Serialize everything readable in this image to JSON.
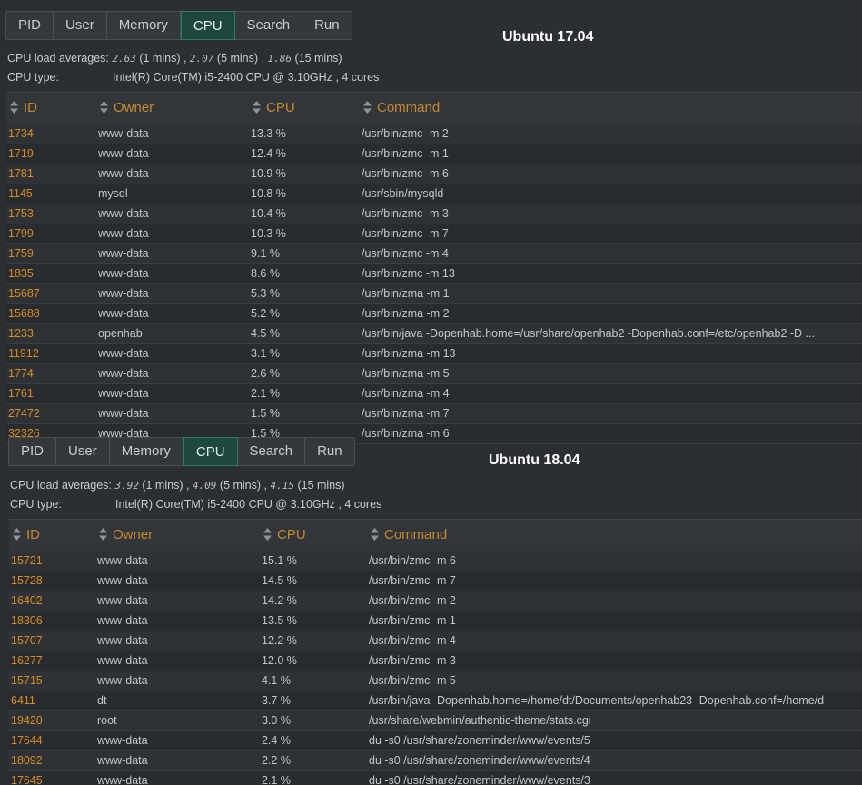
{
  "panels": [
    {
      "os_title": "Ubuntu 17.04",
      "tabs": [
        "PID",
        "User",
        "Memory",
        "CPU",
        "Search",
        "Run"
      ],
      "active_tab": 3,
      "load_label": "CPU load averages:",
      "load": {
        "one": "2.63",
        "one_unit": "(1 mins) ,",
        "five": "2.07",
        "five_unit": "(5 mins) ,",
        "fifteen": "1.86",
        "fifteen_unit": "(15 mins)"
      },
      "type_label": "CPU type:",
      "cpu_type": "Intel(R) Core(TM) i5-2400 CPU @ 3.10GHz , 4 cores",
      "columns": [
        "ID",
        "Owner",
        "CPU",
        "Command"
      ],
      "rows": [
        {
          "id": "1734",
          "owner": "www-data",
          "cpu": "13.3 %",
          "cmd": "/usr/bin/zmc -m 2"
        },
        {
          "id": "1719",
          "owner": "www-data",
          "cpu": "12.4 %",
          "cmd": "/usr/bin/zmc -m 1"
        },
        {
          "id": "1781",
          "owner": "www-data",
          "cpu": "10.9 %",
          "cmd": "/usr/bin/zmc -m 6"
        },
        {
          "id": "1145",
          "owner": "mysql",
          "cpu": "10.8 %",
          "cmd": "/usr/sbin/mysqld"
        },
        {
          "id": "1753",
          "owner": "www-data",
          "cpu": "10.4 %",
          "cmd": "/usr/bin/zmc -m 3"
        },
        {
          "id": "1799",
          "owner": "www-data",
          "cpu": "10.3 %",
          "cmd": "/usr/bin/zmc -m 7"
        },
        {
          "id": "1759",
          "owner": "www-data",
          "cpu": "9.1 %",
          "cmd": "/usr/bin/zmc -m 4"
        },
        {
          "id": "1835",
          "owner": "www-data",
          "cpu": "8.6 %",
          "cmd": "/usr/bin/zmc -m 13"
        },
        {
          "id": "15687",
          "owner": "www-data",
          "cpu": "5.3 %",
          "cmd": "/usr/bin/zma -m 1"
        },
        {
          "id": "15688",
          "owner": "www-data",
          "cpu": "5.2 %",
          "cmd": "/usr/bin/zma -m 2"
        },
        {
          "id": "1233",
          "owner": "openhab",
          "cpu": "4.5 %",
          "cmd": "/usr/bin/java -Dopenhab.home=/usr/share/openhab2 -Dopenhab.conf=/etc/openhab2 -D ..."
        },
        {
          "id": "11912",
          "owner": "www-data",
          "cpu": "3.1 %",
          "cmd": "/usr/bin/zma -m 13"
        },
        {
          "id": "1774",
          "owner": "www-data",
          "cpu": "2.6 %",
          "cmd": "/usr/bin/zma -m 5"
        },
        {
          "id": "1761",
          "owner": "www-data",
          "cpu": "2.1 %",
          "cmd": "/usr/bin/zma -m 4"
        },
        {
          "id": "27472",
          "owner": "www-data",
          "cpu": "1.5 %",
          "cmd": "/usr/bin/zma -m 7"
        },
        {
          "id": "32326",
          "owner": "www-data",
          "cpu": "1.5 %",
          "cmd": "/usr/bin/zma -m 6"
        }
      ]
    },
    {
      "os_title": "Ubuntu 18.04",
      "tabs": [
        "PID",
        "User",
        "Memory",
        "CPU",
        "Search",
        "Run"
      ],
      "active_tab": 3,
      "load_label": "CPU load averages:",
      "load": {
        "one": "3.92",
        "one_unit": "(1 mins) ,",
        "five": "4.09",
        "five_unit": "(5 mins) ,",
        "fifteen": "4.15",
        "fifteen_unit": "(15 mins)"
      },
      "type_label": "CPU type:",
      "cpu_type": "Intel(R) Core(TM) i5-2400 CPU @ 3.10GHz , 4 cores",
      "columns": [
        "ID",
        "Owner",
        "CPU",
        "Command"
      ],
      "rows": [
        {
          "id": "15721",
          "owner": "www-data",
          "cpu": "15.1 %",
          "cmd": "/usr/bin/zmc -m 6"
        },
        {
          "id": "15728",
          "owner": "www-data",
          "cpu": "14.5 %",
          "cmd": "/usr/bin/zmc -m 7"
        },
        {
          "id": "16402",
          "owner": "www-data",
          "cpu": "14.2 %",
          "cmd": "/usr/bin/zmc -m 2"
        },
        {
          "id": "18306",
          "owner": "www-data",
          "cpu": "13.5 %",
          "cmd": "/usr/bin/zmc -m 1"
        },
        {
          "id": "15707",
          "owner": "www-data",
          "cpu": "12.2 %",
          "cmd": "/usr/bin/zmc -m 4"
        },
        {
          "id": "16277",
          "owner": "www-data",
          "cpu": "12.0 %",
          "cmd": "/usr/bin/zmc -m 3"
        },
        {
          "id": "15715",
          "owner": "www-data",
          "cpu": "4.1 %",
          "cmd": "/usr/bin/zmc -m 5"
        },
        {
          "id": "6411",
          "owner": "dt",
          "cpu": "3.7 %",
          "cmd": "/usr/bin/java -Dopenhab.home=/home/dt/Documents/openhab23 -Dopenhab.conf=/home/d"
        },
        {
          "id": "19420",
          "owner": "root",
          "cpu": "3.0 %",
          "cmd": "/usr/share/webmin/authentic-theme/stats.cgi"
        },
        {
          "id": "17644",
          "owner": "www-data",
          "cpu": "2.4 %",
          "cmd": "du -s0 /usr/share/zoneminder/www/events/5"
        },
        {
          "id": "18092",
          "owner": "www-data",
          "cpu": "2.2 %",
          "cmd": "du -s0 /usr/share/zoneminder/www/events/4"
        },
        {
          "id": "17645",
          "owner": "www-data",
          "cpu": "2.1 %",
          "cmd": "du -s0 /usr/share/zoneminder/www/events/3"
        }
      ]
    }
  ]
}
